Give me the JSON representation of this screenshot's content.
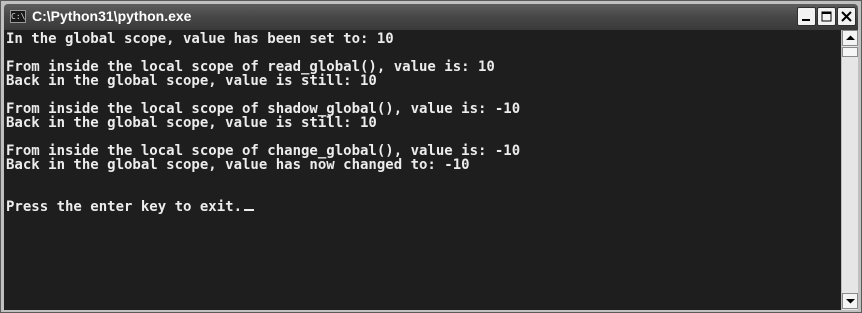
{
  "window": {
    "title": "C:\\Python31\\python.exe",
    "icon": "console-icon",
    "icon_glyph": "C:\\",
    "controls": [
      "minimize",
      "maximize",
      "close"
    ]
  },
  "console": {
    "lines": [
      "In the global scope, value has been set to: 10",
      "",
      "From inside the local scope of read_global(), value is: 10",
      "Back in the global scope, value is still: 10",
      "",
      "From inside the local scope of shadow_global(), value is: -10",
      "Back in the global scope, value is still: 10",
      "",
      "From inside the local scope of change_global(), value is: -10",
      "Back in the global scope, value has now changed to: -10",
      "",
      "",
      "Press the enter key to exit."
    ]
  },
  "colors": {
    "console_background": "#1e1e1e",
    "console_text": "#ececec",
    "titlebar": "#474747"
  }
}
